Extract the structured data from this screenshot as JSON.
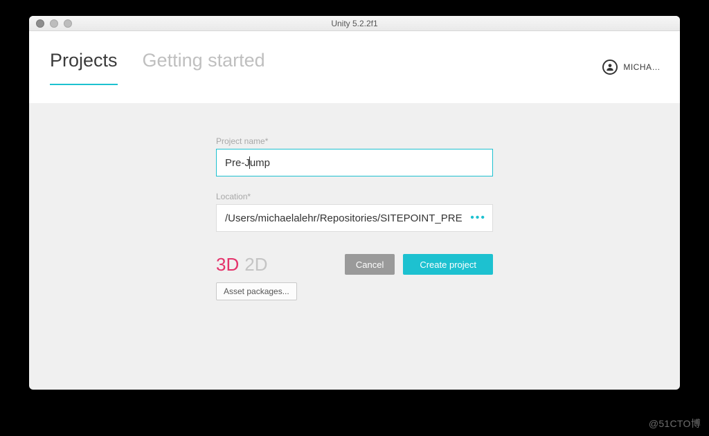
{
  "window": {
    "title": "Unity 5.2.2f1"
  },
  "tabs": {
    "projects": "Projects",
    "getting_started": "Getting started"
  },
  "user": {
    "name": "MICHA…"
  },
  "form": {
    "project_name_label": "Project name*",
    "project_name_value_pre": "Pre-J",
    "project_name_value_post": "ump",
    "location_label": "Location*",
    "location_value": "/Users/michaelalehr/Repositories/SITEPOINT_PRE",
    "location_browse": "•••"
  },
  "mode": {
    "option_3d": "3D",
    "option_2d": "2D"
  },
  "buttons": {
    "asset_packages": "Asset packages...",
    "cancel": "Cancel",
    "create": "Create project"
  },
  "watermark": "@51CTO博"
}
